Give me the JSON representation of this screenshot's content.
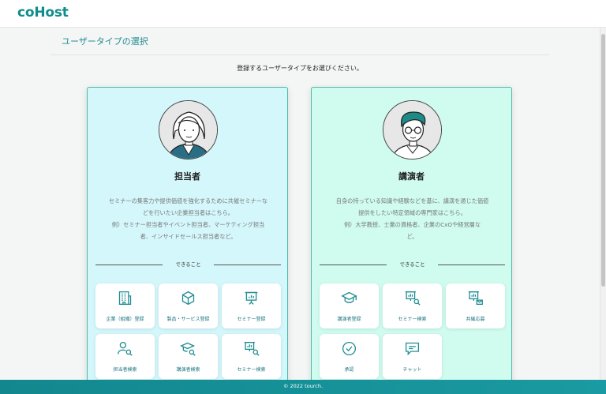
{
  "header": {
    "logo": "coHost"
  },
  "page": {
    "title": "ユーザータイプの選択",
    "subtitle": "登録するユーザータイプをお選びください。"
  },
  "cards": [
    {
      "title": "担当者",
      "desc1": "セミナーの集客力や提供価値を強化するために共催セミナーな",
      "desc2": "どを行いたい企業担当者はこちら。",
      "desc3": "例）セミナー担当者やイベント担当者、マーケティング担当",
      "desc4": "者、インサイドセールス担当者など。",
      "can_label": "できること",
      "tiles": [
        {
          "label": "企業（組織）登録",
          "icon": "building-icon"
        },
        {
          "label": "製品・サービス登録",
          "icon": "cube-icon"
        },
        {
          "label": "セミナー登録",
          "icon": "presentation-icon"
        },
        {
          "label": "担当者検索",
          "icon": "person-search-icon"
        },
        {
          "label": "講演者検索",
          "icon": "graduation-search-icon"
        },
        {
          "label": "セミナー検索",
          "icon": "presentation-search-icon"
        }
      ]
    },
    {
      "title": "講演者",
      "desc1": "自身の持っている知識や経験などを基に、講演を通じた価値",
      "desc2": "提供をしたい特定領域の専門家はこちら。",
      "desc3": "例）大学教授、士業の資格者、企業のCxOや経営層な",
      "desc4": "ど。",
      "can_label": "できること",
      "tiles": [
        {
          "label": "講演者登録",
          "icon": "graduation-cap-icon"
        },
        {
          "label": "セミナー検索",
          "icon": "presentation-search-icon"
        },
        {
          "label": "共催応募",
          "icon": "presentation-mail-icon"
        },
        {
          "label": "承認",
          "icon": "check-circle-icon"
        },
        {
          "label": "チャット",
          "icon": "chat-icon"
        }
      ]
    }
  ],
  "footer": {
    "text": "© 2022 tourch."
  },
  "colors": {
    "accent": "#1f8d91",
    "card_left_bg": "#d4f7fb",
    "card_right_bg": "#cffcef",
    "border": "#4dbaa8"
  }
}
